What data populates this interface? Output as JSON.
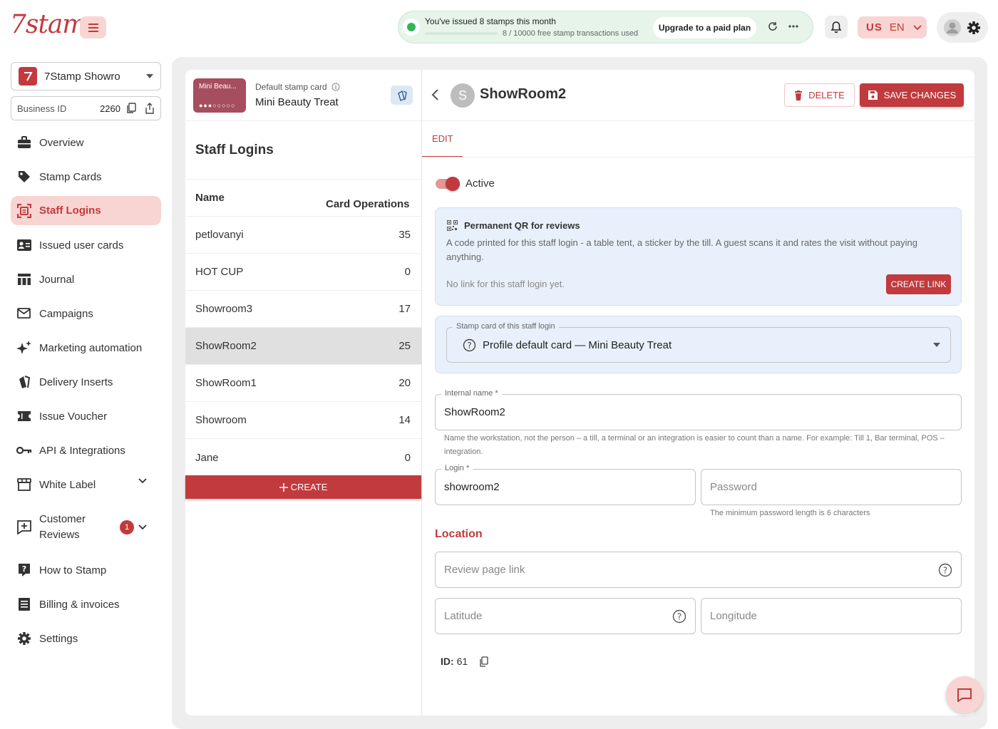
{
  "header": {
    "logo": "7stamp",
    "notice": {
      "message": "You've issued 8 stamps this month",
      "usage": "8 / 10000 free stamp transactions used",
      "progress_fraction": 0.0008,
      "upgrade_label": "Upgrade to a paid plan"
    },
    "lang": {
      "flag": "US",
      "code": "EN"
    }
  },
  "sidebar": {
    "business_name": "7Stamp Showro",
    "business_id_label": "Business ID",
    "business_id": "2260",
    "items": [
      {
        "label": "Overview",
        "icon": "briefcase-icon"
      },
      {
        "label": "Stamp Cards",
        "icon": "tag-icon"
      },
      {
        "label": "Staff Logins",
        "icon": "badge-icon",
        "active": true
      },
      {
        "label": "Issued user cards",
        "icon": "id-card-icon"
      },
      {
        "label": "Journal",
        "icon": "table-icon"
      },
      {
        "label": "Campaigns",
        "icon": "mail-icon"
      },
      {
        "label": "Marketing automation",
        "icon": "sparkle-icon"
      },
      {
        "label": "Delivery Inserts",
        "icon": "cards-icon"
      },
      {
        "label": "Issue Voucher",
        "icon": "voucher-icon"
      },
      {
        "label": "API & Integrations",
        "icon": "key-icon"
      },
      {
        "label": "White Label",
        "icon": "storefront-icon"
      },
      {
        "label": "Customer Reviews",
        "icon": "review-icon",
        "badge": "1"
      },
      {
        "label": "How to Stamp",
        "icon": "help-icon"
      },
      {
        "label": "Billing & invoices",
        "icon": "receipt-icon"
      },
      {
        "label": "Settings",
        "icon": "gear-icon"
      }
    ]
  },
  "card": {
    "thumb_label": "Mini Beau...",
    "default_label": "Default stamp card",
    "name": "Mini Beauty Treat"
  },
  "staff": {
    "title": "Staff Logins",
    "col_name": "Name",
    "col_ops": "Card Operations",
    "rows": [
      {
        "name": "petlovanyi",
        "ops": "35"
      },
      {
        "name": "HOT CUP",
        "ops": "0"
      },
      {
        "name": "Showroom3",
        "ops": "17"
      },
      {
        "name": "ShowRoom2",
        "ops": "25",
        "selected": true
      },
      {
        "name": "ShowRoom1",
        "ops": "20"
      },
      {
        "name": "Showroom",
        "ops": "14"
      },
      {
        "name": "Jane",
        "ops": "0"
      }
    ],
    "create_label": "CREATE"
  },
  "detail": {
    "avatar_letter": "S",
    "title": "ShowRoom2",
    "delete_label": "DELETE",
    "save_label": "SAVE CHANGES",
    "tab_edit": "EDIT",
    "active_label": "Active",
    "active": true,
    "qr": {
      "title": "Permanent QR for reviews",
      "desc": "A code printed for this staff login - a table tent, a sticker by the till. A guest scans it and rates the visit without paying anything.",
      "no_link": "No link for this staff login yet.",
      "create_link": "CREATE LINK"
    },
    "stamp_card_legend": "Stamp card of this staff login",
    "stamp_card_value": "Profile default card — Mini Beauty Treat",
    "internal_name_label": "Internal name *",
    "internal_name": "ShowRoom2",
    "internal_name_help": "Name the workstation, not the person – a till, a terminal or an integration is easier to count than a name. For example: Till 1, Bar terminal, POS – integration.",
    "login_label": "Login *",
    "login": "showroom2",
    "password_placeholder": "Password",
    "password_help": "The minimum password length is 6 characters",
    "location_title": "Location",
    "review_link_placeholder": "Review page link",
    "latitude_placeholder": "Latitude",
    "longitude_placeholder": "Longitude",
    "id_label": "ID:",
    "id_value": "61"
  },
  "colors": {
    "accent": "#c13a3d",
    "accent_soft": "#f8d5d2",
    "info_bg": "#e8f1fb",
    "success": "#32b45a"
  }
}
